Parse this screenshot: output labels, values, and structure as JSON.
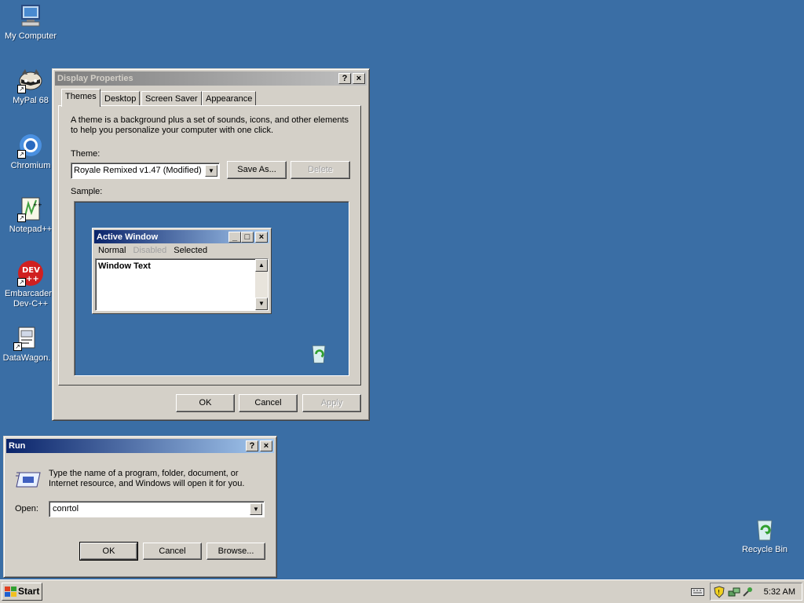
{
  "desktop": {
    "icons": [
      {
        "label": "My Computer"
      },
      {
        "label": "MyPal 68"
      },
      {
        "label": "Chromium"
      },
      {
        "label": "Notepad++"
      },
      {
        "label": "Embarcadero Dev-C++"
      },
      {
        "label": "DataWagon."
      },
      {
        "label": "Recycle Bin"
      }
    ]
  },
  "display": {
    "title": "Display Properties",
    "help": "?",
    "close": "×",
    "tabs": [
      "Themes",
      "Desktop",
      "Screen Saver",
      "Appearance"
    ],
    "description": "A theme is a background plus a set of sounds, icons, and other elements to help you personalize your computer with one click.",
    "theme_label": "Theme:",
    "theme_value": "Royale Remixed v1.47 (Modified)",
    "save_as": "Save As...",
    "delete": "Delete",
    "sample_label": "Sample:",
    "sample": {
      "active_title": "Active Window",
      "menu": [
        "Normal",
        "Disabled",
        "Selected"
      ],
      "window_text": "Window Text"
    },
    "ok": "OK",
    "cancel": "Cancel",
    "apply": "Apply"
  },
  "run": {
    "title": "Run",
    "help": "?",
    "close": "×",
    "description": "Type the name of a program, folder, document, or Internet resource, and Windows will open it for you.",
    "open_label": "Open:",
    "open_value": "conrtol",
    "ok": "OK",
    "cancel": "Cancel",
    "browse": "Browse..."
  },
  "taskbar": {
    "start": "Start",
    "clock": "5:32 AM"
  },
  "colors": {
    "desktop": "#3a6ea5",
    "face": "#d4d0c8",
    "active_title": "#0a246a"
  }
}
